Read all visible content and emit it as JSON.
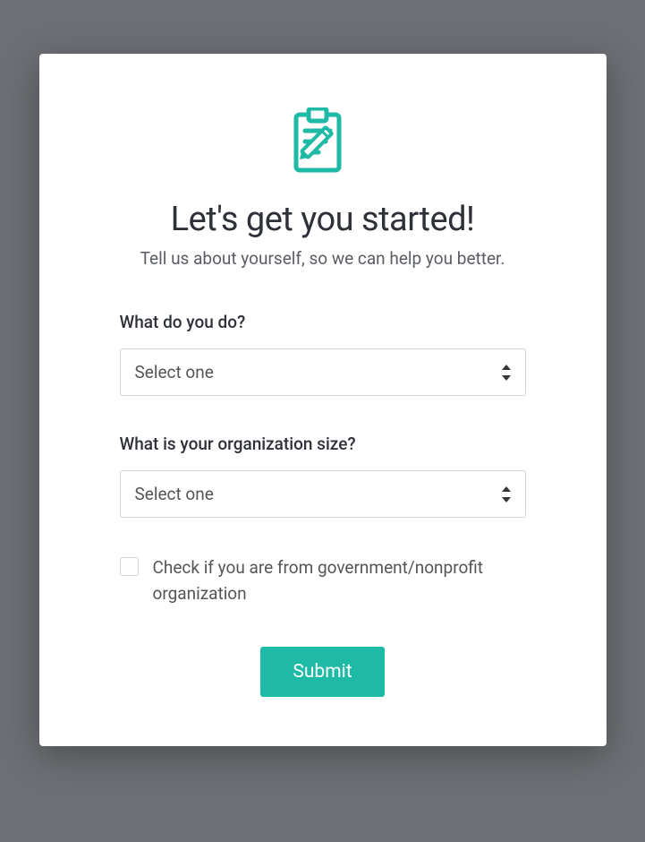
{
  "header": {
    "title": "Let's get you started!",
    "subtitle": "Tell us about yourself, so we can help you better."
  },
  "form": {
    "role": {
      "label": "What do you do?",
      "placeholder": "Select one"
    },
    "org_size": {
      "label": "What is your organization size?",
      "placeholder": "Select one"
    },
    "nonprofit": {
      "label": "Check if you are from government/nonprofit organization"
    },
    "submit_label": "Submit"
  },
  "colors": {
    "accent": "#1fbaa6"
  }
}
